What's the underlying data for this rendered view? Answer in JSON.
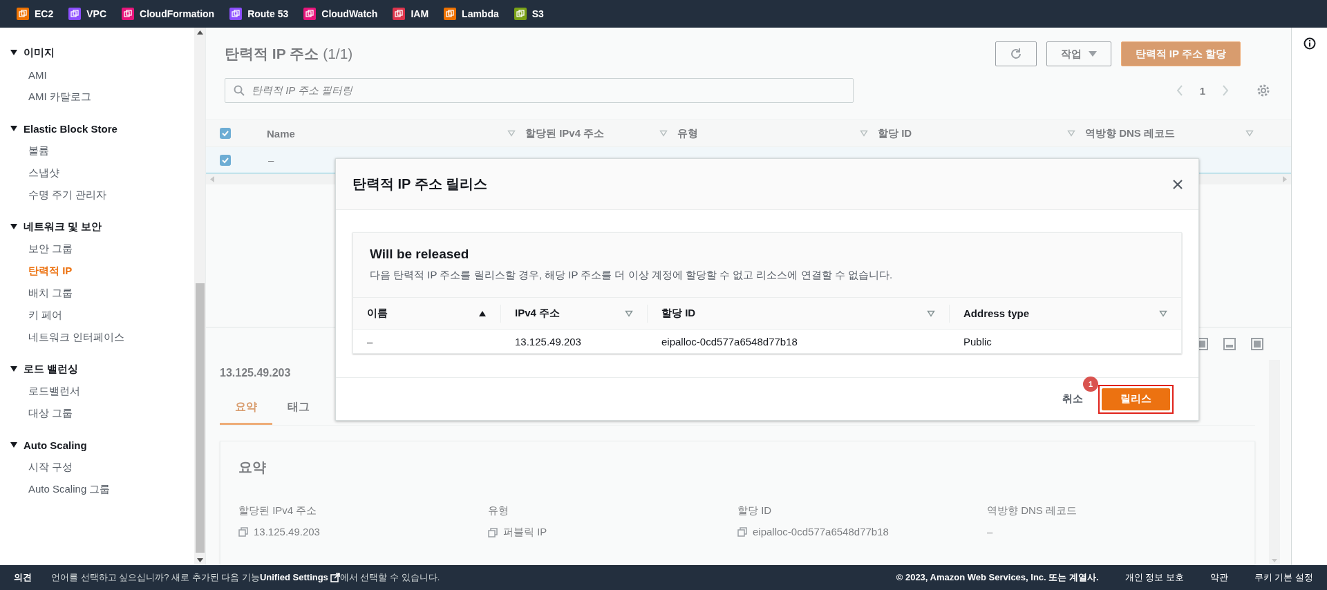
{
  "top_nav": {
    "services": [
      {
        "label": "EC2",
        "color": "#ed7100"
      },
      {
        "label": "VPC",
        "color": "#8c4fff"
      },
      {
        "label": "CloudFormation",
        "color": "#e7157b"
      },
      {
        "label": "Route 53",
        "color": "#8c4fff"
      },
      {
        "label": "CloudWatch",
        "color": "#e7157b"
      },
      {
        "label": "IAM",
        "color": "#dd344c"
      },
      {
        "label": "Lambda",
        "color": "#ed7100"
      },
      {
        "label": "S3",
        "color": "#7aa116"
      }
    ]
  },
  "sidebar": {
    "sections": [
      {
        "title": "이미지",
        "expanded": true,
        "items": [
          {
            "label": "AMI",
            "selected": false
          },
          {
            "label": "AMI 카탈로그",
            "selected": false
          }
        ]
      },
      {
        "title": "Elastic Block Store",
        "expanded": true,
        "items": [
          {
            "label": "볼륨",
            "selected": false
          },
          {
            "label": "스냅샷",
            "selected": false
          },
          {
            "label": "수명 주기 관리자",
            "selected": false
          }
        ]
      },
      {
        "title": "네트워크 및 보안",
        "expanded": true,
        "items": [
          {
            "label": "보안 그룹",
            "selected": false
          },
          {
            "label": "탄력적 IP",
            "selected": true
          },
          {
            "label": "배치 그룹",
            "selected": false
          },
          {
            "label": "키 페어",
            "selected": false
          },
          {
            "label": "네트워크 인터페이스",
            "selected": false
          }
        ]
      },
      {
        "title": "로드 밸런싱",
        "expanded": true,
        "items": [
          {
            "label": "로드밸런서",
            "selected": false
          },
          {
            "label": "대상 그룹",
            "selected": false
          }
        ]
      },
      {
        "title": "Auto Scaling",
        "expanded": true,
        "items": [
          {
            "label": "시작 구성",
            "selected": false
          },
          {
            "label": "Auto Scaling 그룹",
            "selected": false
          }
        ]
      }
    ]
  },
  "page_header": {
    "title": "탄력적 IP 주소",
    "count": "(1/1)",
    "actions_label": "작업",
    "allocate_label": "탄력적 IP 주소 할당"
  },
  "search": {
    "placeholder": "탄력적 IP 주소 필터링"
  },
  "pagination": {
    "page": "1"
  },
  "table": {
    "all_checked": true,
    "columns": [
      "Name",
      "할당된 IPv4 주소",
      "유형",
      "할당 ID",
      "역방향 DNS 레코드"
    ],
    "rows": [
      {
        "checked": true,
        "name": "–"
      }
    ]
  },
  "detail": {
    "title": "13.125.49.203",
    "tabs": [
      {
        "label": "요약",
        "selected": true
      },
      {
        "label": "태그",
        "selected": false
      }
    ],
    "summary": {
      "title": "요약",
      "fields": [
        {
          "label": "할당된 IPv4 주소",
          "value": "13.125.49.203",
          "copy": true
        },
        {
          "label": "유형",
          "value": "퍼블릭 IP",
          "copy": true
        },
        {
          "label": "할당 ID",
          "value": "eipalloc-0cd577a6548d77b18",
          "copy": true
        },
        {
          "label": "역방향 DNS 레코드",
          "value": "–",
          "copy": false
        }
      ]
    }
  },
  "modal": {
    "title": "탄력적 IP 주소 릴리스",
    "container": {
      "title": "Will be released",
      "description": "다음 탄력적 IP 주소를 릴리스할 경우, 해당 IP 주소를 더 이상 계정에 할당할 수 없고 리소스에 연결할 수 없습니다.",
      "columns": [
        {
          "label": "이름",
          "sorted": true
        },
        {
          "label": "IPv4 주소",
          "sorted": false
        },
        {
          "label": "할당 ID",
          "sorted": false
        },
        {
          "label": "Address type",
          "sorted": false
        }
      ],
      "rows": [
        [
          "–",
          "13.125.49.203",
          "eipalloc-0cd577a6548d77b18",
          "Public"
        ]
      ]
    },
    "cancel": "취소",
    "confirm": "릴리스",
    "confirm_highlighted": true,
    "badge": "1"
  },
  "footer": {
    "feedback": "의견",
    "notice_before": "언어를 선택하고 싶으십니까? 새로 추가된 다음 기능",
    "notice_link": "Unified Settings",
    "notice_after": "에서 선택할 수 있습니다.",
    "copyright": "© 2023, Amazon Web Services, Inc. 또는 계열사.",
    "links": [
      "개인 정보 보호",
      "약관",
      "쿠키 기본 설정"
    ]
  }
}
